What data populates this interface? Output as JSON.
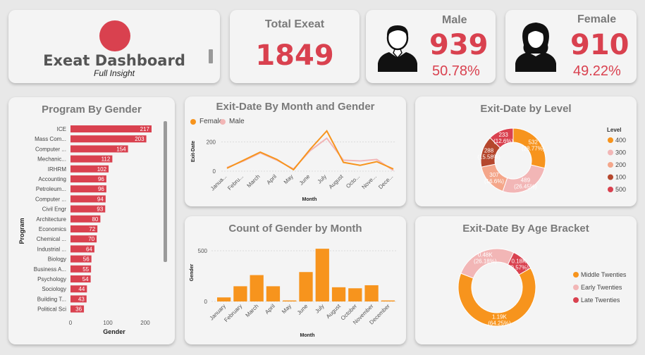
{
  "header": {
    "title": "Exeat Dashboard",
    "subtitle": "Full Insight"
  },
  "kpi_total": {
    "label": "Total Exeat",
    "value": "1849"
  },
  "kpi_male": {
    "label": "Male",
    "value": "939",
    "pct": "50.78%"
  },
  "kpi_female": {
    "label": "Female",
    "value": "910",
    "pct": "49.22%"
  },
  "colors": {
    "red": "#d9414f",
    "orange": "#f7941d",
    "pink": "#f2b6b6",
    "brown": "#b5472d",
    "peach": "#f4a68a",
    "salmon": "#f08b6e"
  },
  "chart_data": [
    {
      "id": "program",
      "type": "bar",
      "title": "Program By Gender",
      "xlabel": "Gender",
      "ylabel": "Program",
      "categories": [
        "ICE",
        "Mass Com...",
        "Computer ...",
        "Mechanic...",
        "IRHRM",
        "Accounting",
        "Petroleum...",
        "Computer ...",
        "Civil Engr",
        "Architecture",
        "Economics",
        "Chemical ...",
        "Industrial ...",
        "Biology",
        "Business A...",
        "Psychology",
        "Sociology",
        "Building T...",
        "Political Sci"
      ],
      "values": [
        217,
        203,
        154,
        112,
        102,
        96,
        96,
        94,
        93,
        80,
        72,
        70,
        64,
        56,
        55,
        54,
        44,
        43,
        36
      ],
      "xticks": [
        "0",
        "100",
        "200"
      ],
      "xlim": [
        0,
        230
      ]
    },
    {
      "id": "month_gender",
      "type": "line",
      "title": "Exit-Date By Month and Gender",
      "xlabel": "Month",
      "ylabel": "Exit-Date",
      "categories": [
        "Janua...",
        "Febru...",
        "March",
        "April",
        "May",
        "June",
        "July",
        "August",
        "Octo...",
        "Nove...",
        "Dece..."
      ],
      "series": [
        {
          "name": "Female",
          "values": [
            20,
            75,
            130,
            80,
            10,
            150,
            275,
            60,
            40,
            65,
            15
          ]
        },
        {
          "name": "Male",
          "values": [
            25,
            70,
            125,
            75,
            15,
            140,
            225,
            75,
            70,
            80,
            5
          ]
        }
      ],
      "yticks": [
        "0",
        "200"
      ],
      "ylim": [
        0,
        320
      ]
    },
    {
      "id": "level",
      "type": "pie",
      "title": "Exit-Date by Level",
      "legend_title": "Level",
      "labels": [
        "400",
        "300",
        "200",
        "100",
        "500"
      ],
      "values": [
        532,
        489,
        307,
        288,
        233
      ],
      "display": [
        "532 (28.77%)",
        "489 (26.45%)",
        "307 (16.6%)",
        "288 (15.58%)",
        "233 (12.6%)"
      ],
      "display_split": [
        [
          "532",
          "(28.77%)"
        ],
        [
          "489",
          "(26.45%)"
        ],
        [
          "307",
          "(16.6%)"
        ],
        [
          "288",
          "(15.58%)"
        ],
        [
          "233",
          "(12.6%)"
        ]
      ]
    },
    {
      "id": "gender_month",
      "type": "bar",
      "title": "Count of Gender by Month",
      "xlabel": "Month",
      "ylabel": "Gender",
      "categories": [
        "January",
        "February",
        "March",
        "April",
        "May",
        "June",
        "July",
        "August",
        "October",
        "November",
        "December"
      ],
      "values": [
        40,
        150,
        260,
        150,
        10,
        290,
        520,
        140,
        130,
        160,
        10
      ],
      "yticks": [
        "0",
        "500"
      ],
      "ylim": [
        0,
        560
      ]
    },
    {
      "id": "age",
      "type": "pie",
      "title": "Exit-Date By Age Bracket",
      "labels": [
        "Middle Twenties",
        "Early Twenties",
        "Late Twenties"
      ],
      "values": [
        64.25,
        26.18,
        9.57
      ],
      "display": [
        "1.19K (64.25%)",
        "0.48K (26.18%)",
        "0.18K (9.57%)"
      ],
      "display_split": [
        [
          "1.19K",
          "(64.25%)"
        ],
        [
          "0.48K",
          "(26.18%)"
        ],
        [
          "0.18K",
          "(9.57%)"
        ]
      ]
    }
  ]
}
